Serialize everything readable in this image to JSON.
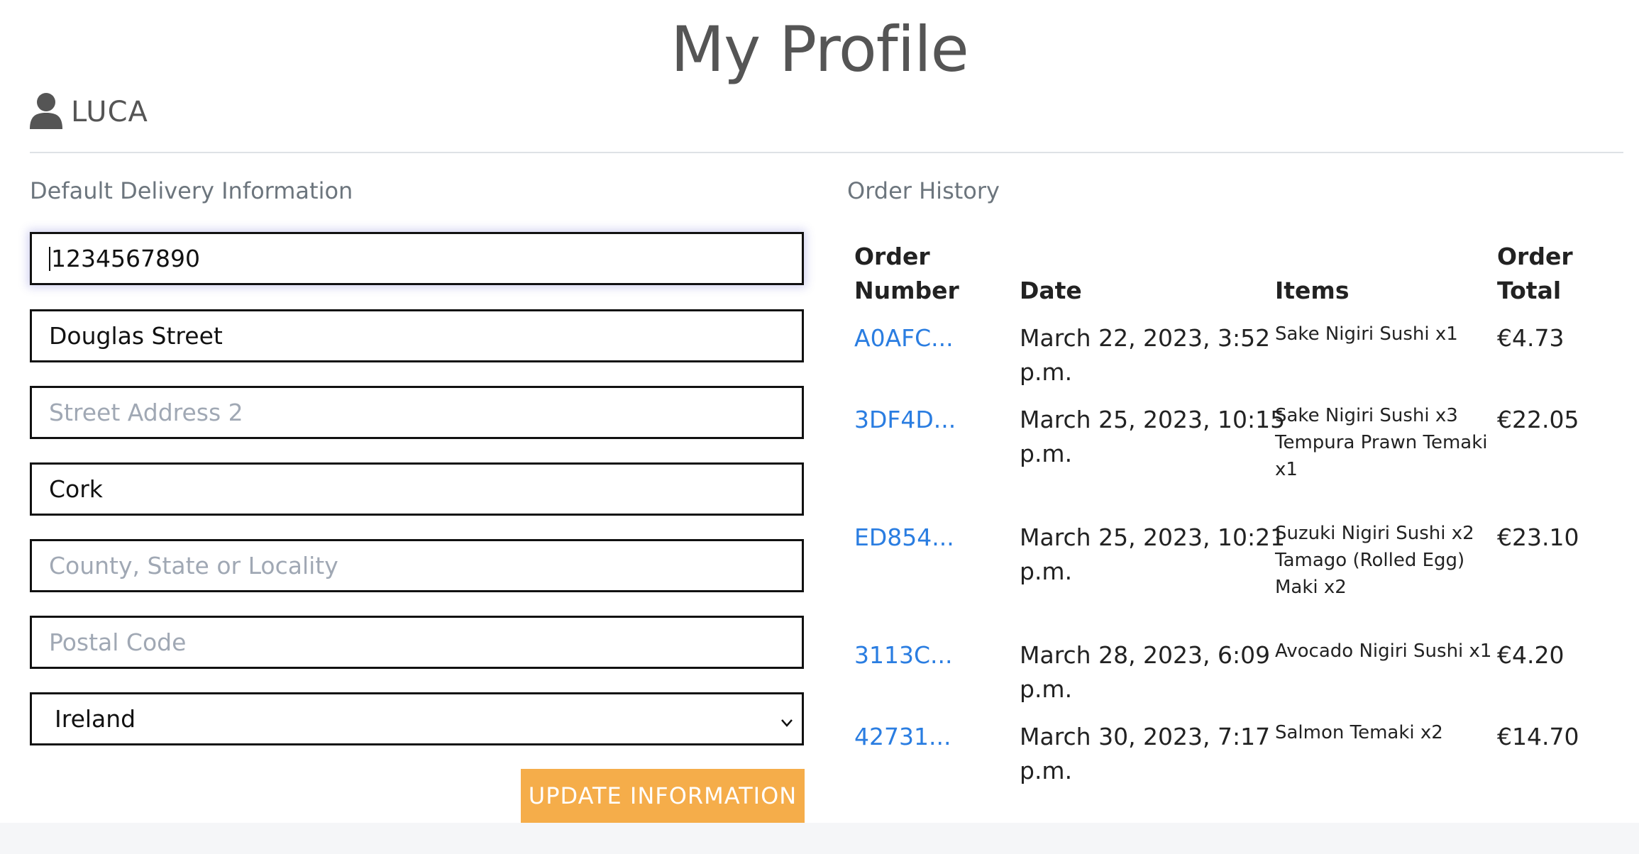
{
  "page_title": "My Profile",
  "user": {
    "name": "LUCA",
    "icon": "user-icon"
  },
  "delivery": {
    "heading": "Default Delivery Information",
    "phone": {
      "value": "1234567890",
      "placeholder": ""
    },
    "street1": {
      "value": "Douglas Street",
      "placeholder": ""
    },
    "street2": {
      "value": "",
      "placeholder": "Street Address 2"
    },
    "town": {
      "value": "Cork",
      "placeholder": ""
    },
    "county": {
      "value": "",
      "placeholder": "County, State or Locality"
    },
    "postcode": {
      "value": "",
      "placeholder": "Postal Code"
    },
    "country": {
      "selected": "Ireland"
    },
    "update_label": "UPDATE INFORMATION"
  },
  "orders": {
    "heading": "Order History",
    "headers": {
      "number": [
        "Order",
        "Number"
      ],
      "date": "Date",
      "items": "Items",
      "total": [
        "Order",
        "Total"
      ]
    },
    "rows": [
      {
        "number": "A0AFC...",
        "date": [
          "March 22, 2023, 3:52",
          "p.m."
        ],
        "items": [
          "Sake Nigiri Sushi x1"
        ],
        "total": "€4.73"
      },
      {
        "number": "3DF4D...",
        "date": [
          "March 25, 2023, 10:15",
          "p.m."
        ],
        "items": [
          "Sake Nigiri Sushi x3",
          "Tempura Prawn Temaki",
          "x1"
        ],
        "total": "€22.05"
      },
      {
        "number": "ED854...",
        "date": [
          "March 25, 2023, 10:21",
          "p.m."
        ],
        "items": [
          "Suzuki Nigiri Sushi x2",
          "Tamago (Rolled Egg)",
          "Maki x2"
        ],
        "total": "€23.10"
      },
      {
        "number": "3113C...",
        "date": [
          "March 28, 2023, 6:09",
          "p.m."
        ],
        "items": [
          "Avocado Nigiri Sushi x1"
        ],
        "total": "€4.20"
      },
      {
        "number": "42731...",
        "date": [
          "March 30, 2023, 7:17",
          "p.m."
        ],
        "items": [
          "Salmon Temaki x2"
        ],
        "total": "€14.70"
      }
    ]
  },
  "colors": {
    "accent": "#f5ad4a",
    "link": "#2a7de1",
    "text": "#555555"
  }
}
